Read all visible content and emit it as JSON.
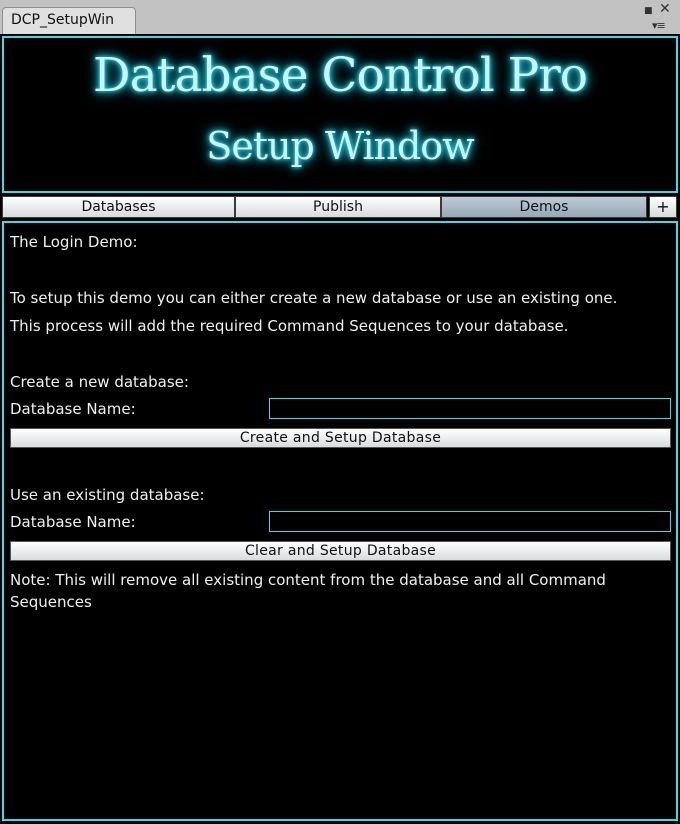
{
  "window": {
    "tab_label": "DCP_SetupWin",
    "maximize_glyph": "■",
    "close_glyph": "✕",
    "menu_glyph": "▾≡"
  },
  "header": {
    "title": "Database Control Pro",
    "subtitle": "Setup Window"
  },
  "tabs": [
    {
      "label": "Databases"
    },
    {
      "label": "Publish"
    },
    {
      "label": "Demos"
    },
    {
      "label": "+"
    }
  ],
  "demo": {
    "heading": "The Login Demo:",
    "intro_line1": "To setup this demo you can either create a new database or use an existing one.",
    "intro_line2": "This process will add the required Command Sequences to your database.",
    "create_heading": "Create a new database:",
    "create_name_label": "Database Name:",
    "create_name_value": "",
    "create_button": "Create and Setup Database",
    "existing_heading": "Use an existing database:",
    "existing_name_label": "Database Name:",
    "existing_name_value": "",
    "clear_button": "Clear and Setup Database",
    "note_line1": "Note: This will remove all existing content from the database and all Command",
    "note_line2": "Sequences"
  },
  "colors": {
    "accent_cyan": "#3fd9ea",
    "background": "#000000",
    "chrome": "#c2c2c2"
  }
}
